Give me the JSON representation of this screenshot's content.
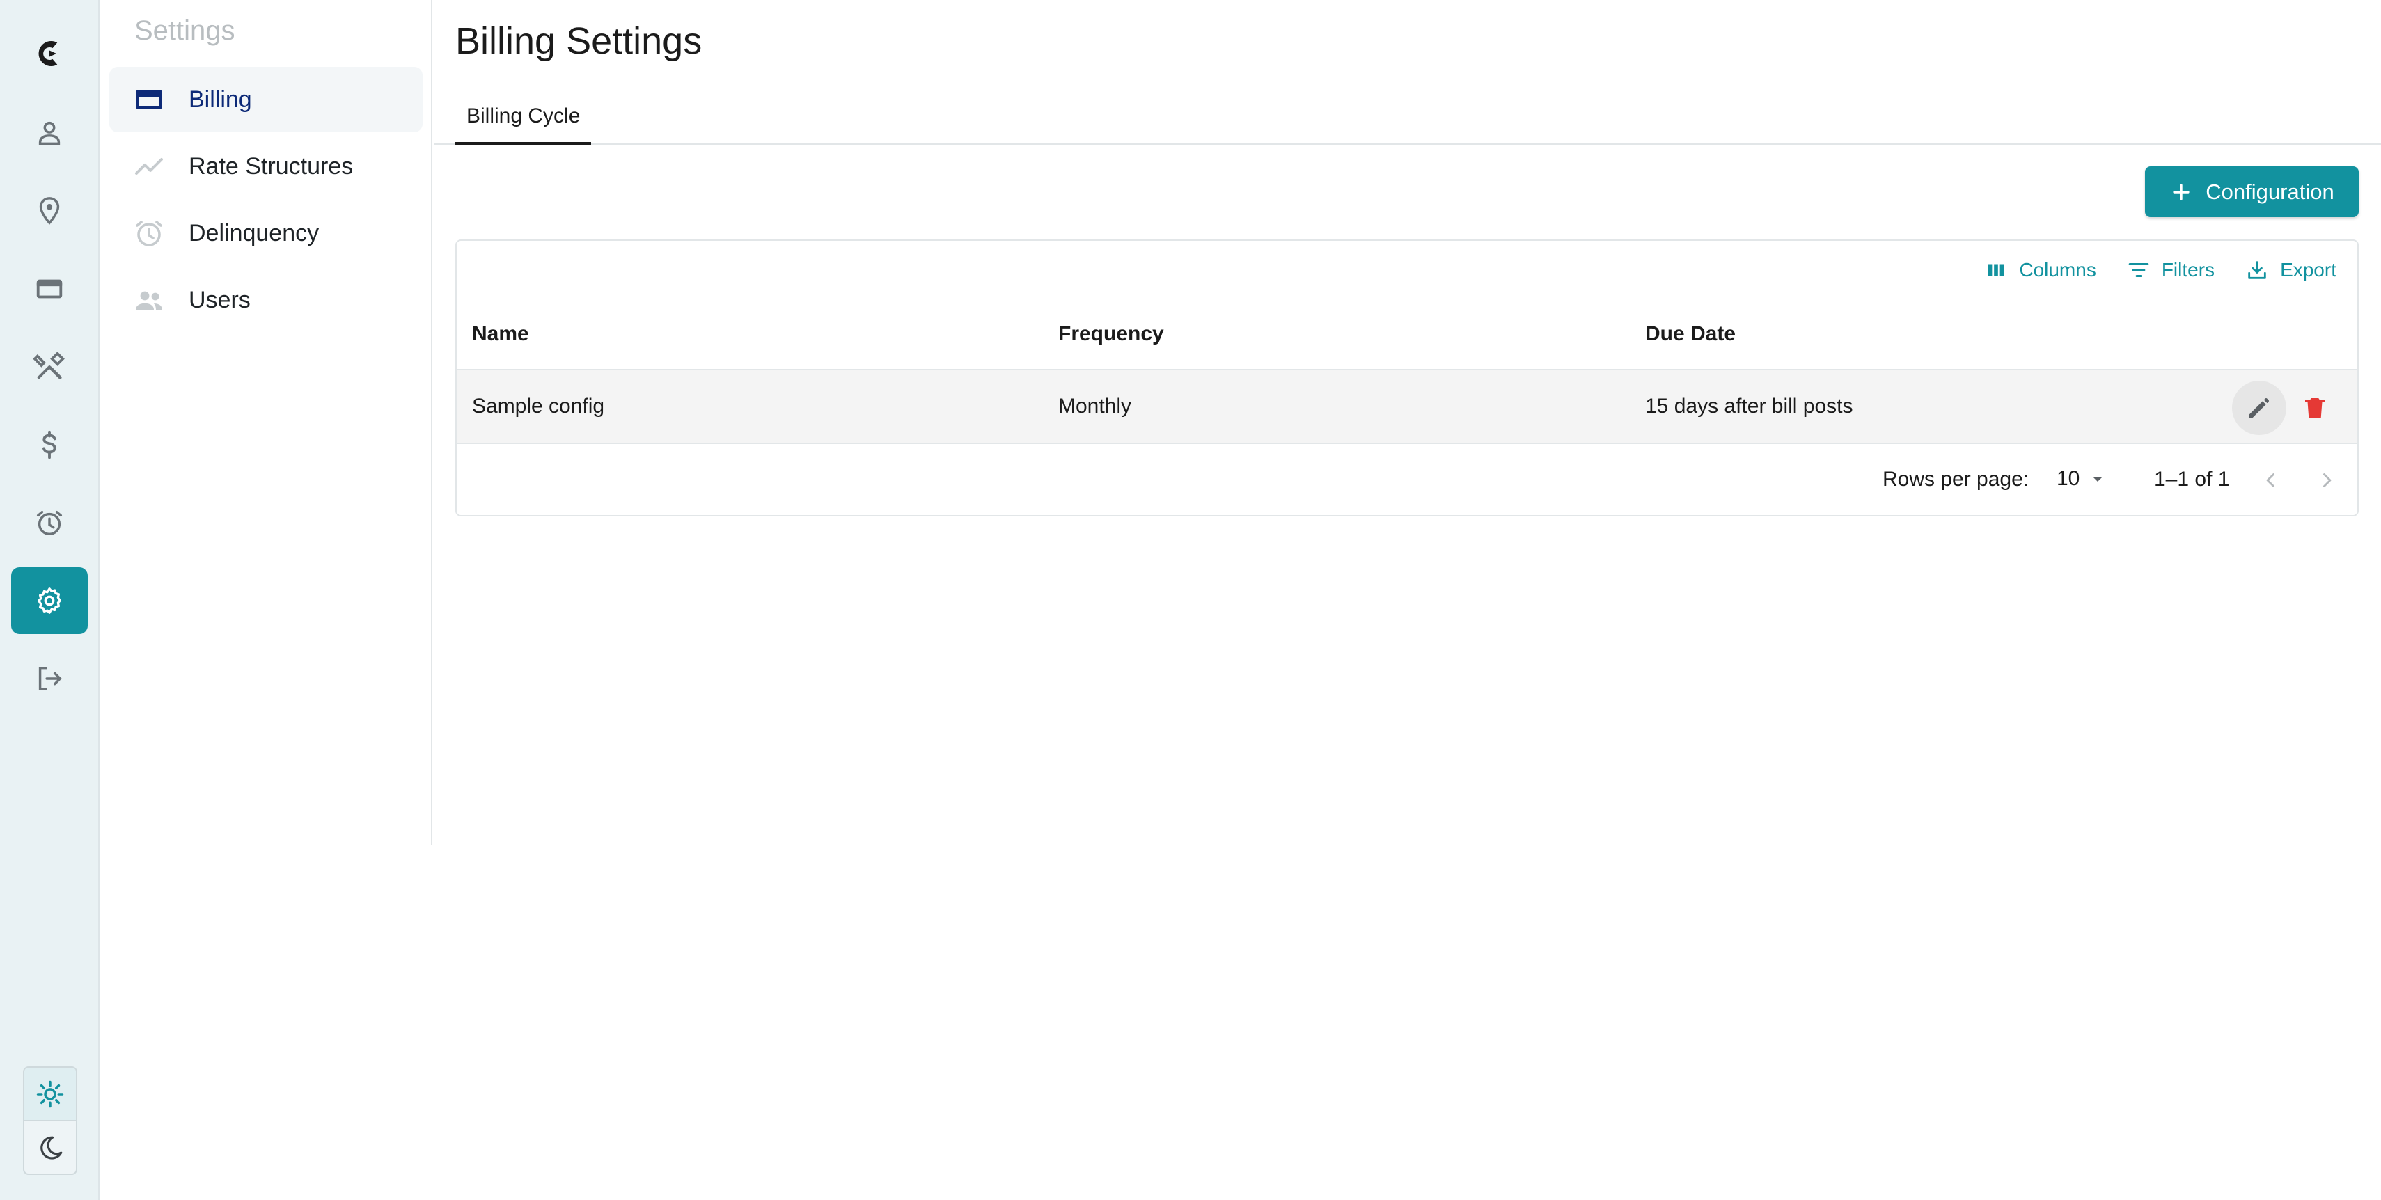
{
  "sidebar": {
    "title": "Settings",
    "items": [
      {
        "label": "Billing"
      },
      {
        "label": "Rate Structures"
      },
      {
        "label": "Delinquency"
      },
      {
        "label": "Users"
      }
    ]
  },
  "rail": {
    "icons": [
      "logo-icon",
      "person-icon",
      "location-icon",
      "credit-card-icon",
      "tools-icon",
      "dollar-icon",
      "alarm-icon",
      "settings-icon",
      "logout-icon",
      "sun-icon",
      "moon-icon"
    ],
    "active": "settings-icon"
  },
  "main": {
    "title": "Billing Settings",
    "tabs": [
      {
        "label": "Billing Cycle"
      }
    ],
    "add_button": "Configuration"
  },
  "grid": {
    "toolbar": {
      "columns": "Columns",
      "filters": "Filters",
      "export": "Export"
    },
    "columns": [
      "Name",
      "Frequency",
      "Due Date"
    ],
    "rows": [
      {
        "name": "Sample config",
        "frequency": "Monthly",
        "due_date": "15 days after bill posts"
      }
    ],
    "footer": {
      "rows_per_page_label": "Rows per page:",
      "rows_per_page_value": "10",
      "range": "1–1 of 1"
    }
  },
  "colors": {
    "accent": "#12929f",
    "brand_nav": "#0d2a78",
    "delete": "#e53935",
    "rail_bg": "#e9f2f4"
  }
}
